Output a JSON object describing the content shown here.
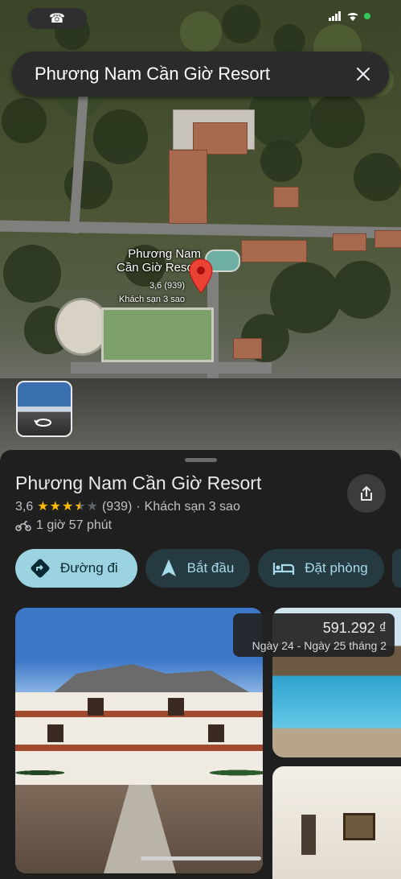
{
  "status_bar": {
    "call_icon": "phone-icon"
  },
  "search": {
    "query": "Phương Nam Cần Giờ Resort",
    "close_icon": "close-icon"
  },
  "map_pin": {
    "title": "Phương Nam\nCần Giờ Resort",
    "rating": "3,6 (939)",
    "type": "Khách sạn 3 sao",
    "pin_color": "#ea4335"
  },
  "place": {
    "name": "Phương Nam Cần Giờ Resort",
    "rating": "3,6",
    "stars": 3.6,
    "reviews": "(939)",
    "separator": "·",
    "category": "Khách sạn 3 sao",
    "travel_icon": "motorbike-icon",
    "travel_time": "1 giờ 57 phút"
  },
  "actions": [
    {
      "label": "Đường đi",
      "icon": "directions-icon"
    },
    {
      "label": "Bắt đầu",
      "icon": "navigation-arrow-icon"
    },
    {
      "label": "Đặt phòng",
      "icon": "bed-icon"
    }
  ],
  "price": {
    "amount": "591.292 ₫",
    "dates": "Ngày 24 - Ngày 25 tháng 2"
  },
  "colors": {
    "primary_chip": "#9bd4e0",
    "chip": "#263a42",
    "sheet": "#1f1f1f",
    "star": "#fbbc04"
  }
}
